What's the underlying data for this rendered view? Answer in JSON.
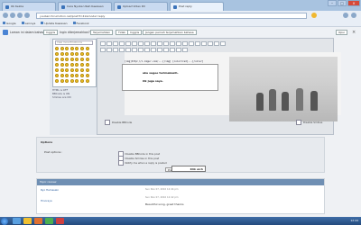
{
  "browser": {
    "tabs": [
      {
        "label": "Ok Kelola"
      },
      {
        "label": "Cara Nyoba Ubah Kawasan"
      },
      {
        "label": "Upload Video Dll"
      },
      {
        "label": "Post reply"
      }
    ],
    "url": "yuubari.forumotion.net/post?t=41&mode=reply",
    "bookmarks": [
      {
        "label": "Google"
      },
      {
        "label": "Lainnya"
      },
      {
        "label": "Update Kawasan"
      },
      {
        "label": "Facebook"
      }
    ]
  },
  "translate_bar": {
    "prefix": "Laman ini dalam bahasa",
    "lang_button": "Inggris",
    "question": "Ingin diterjemahkan?",
    "translate_button": "Terjemahkan",
    "no_button": "Tidak",
    "never_prefix": "Jangan pernah terjemahkan bahasa",
    "never_lang": "Inggris",
    "options": "Opsi"
  },
  "smilies": {
    "header": "View more Emoticons",
    "sidebar_labels": [
      "HTML is OFF",
      "BBCode is ON",
      "Smilies are ON"
    ]
  },
  "editor": {
    "code_text": "[img]http://i.imgur.com/...[/img] [color=red]...[/color]",
    "preview_line_1": "aku sugee terimakasih.",
    "preview_line_2": "Ok juga saya.",
    "checkbox_left": "Disable BBCode",
    "checkbox_right": "Disable Smilies"
  },
  "options": {
    "title": "Options",
    "post_options_label": "Post options :",
    "rows": [
      "Disable BBCode in this post",
      "Disable Smilies in this post",
      "Notify me when a reply is posted"
    ],
    "preview_button": "Preview",
    "send_button": "Send",
    "tooltip": "Klik aich"
  },
  "review": {
    "header": "Topic review",
    "entries": [
      {
        "user": "Ryo Hamasaki",
        "meta": "Sun Nov 07, 2010 12:44 pm",
        "body": ""
      },
      {
        "user": "Hinoraya",
        "meta": "Sun Nov 07, 2010 12:42 pm",
        "body": "Beautiful song, great thanks"
      },
      {
        "user": "Hinoraya",
        "meta": "",
        "body": ""
      }
    ]
  },
  "taskbar": {
    "clock": "12:44"
  }
}
